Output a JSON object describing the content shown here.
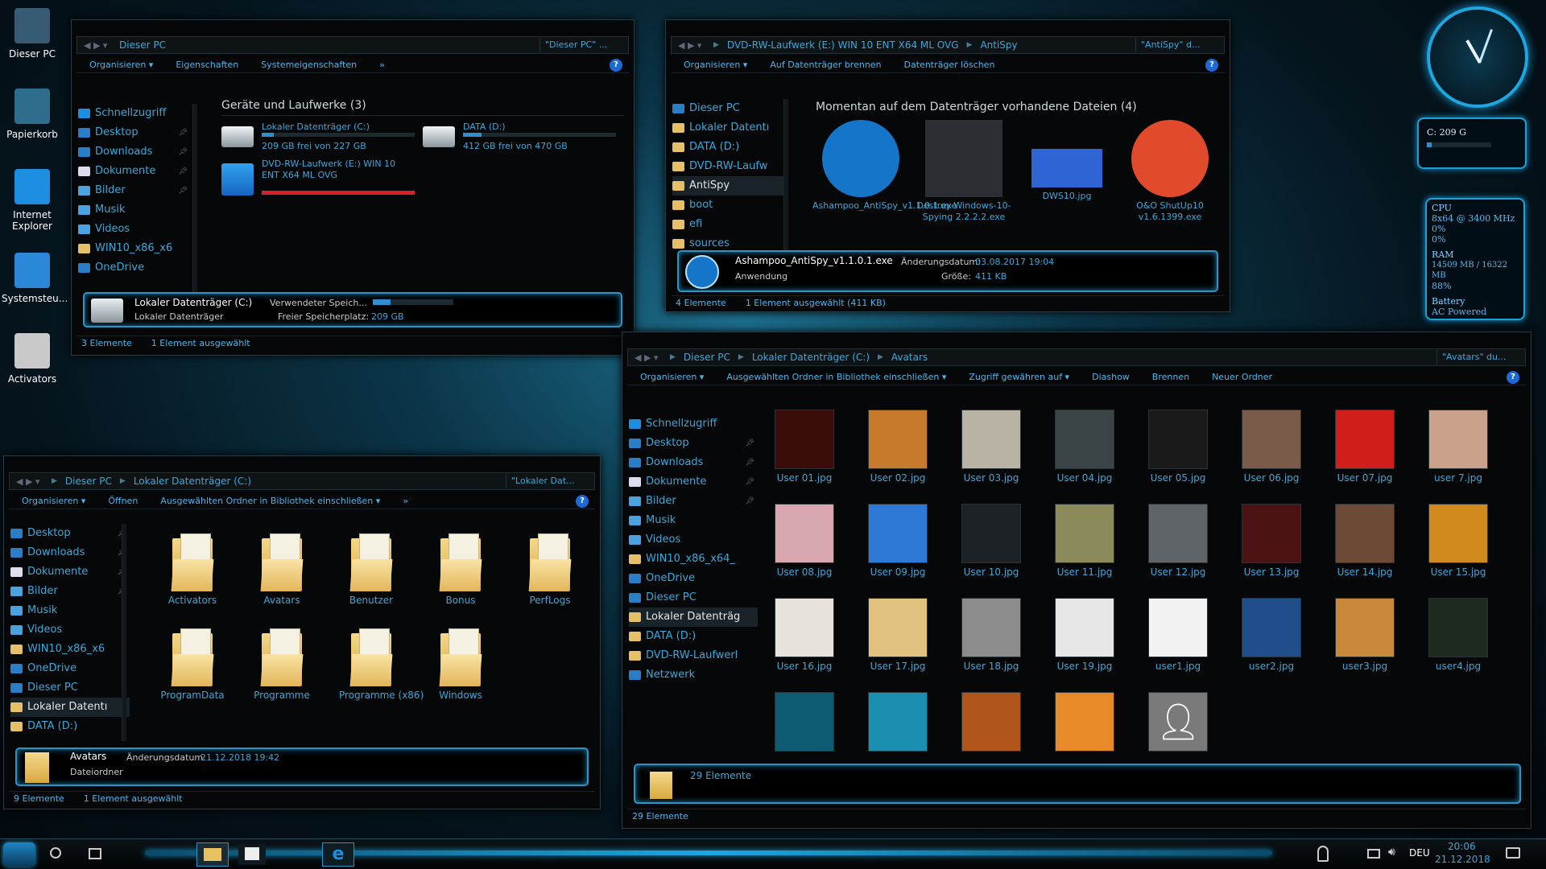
{
  "desktop": {
    "icons": [
      {
        "label": "Dieser PC",
        "color": "#365b72"
      },
      {
        "label": "Papierkorb",
        "color": "#2f6d8c"
      },
      {
        "label": "Internet Explorer",
        "color": "#1e8fe0"
      },
      {
        "label": "Systemsteu...",
        "color": "#2b88d8"
      },
      {
        "label": "Activators",
        "color": "#c9c9c9"
      }
    ]
  },
  "win_pc": {
    "address": {
      "crumbs": [
        "Dieser PC"
      ],
      "search": "\"Dieser PC\" ..."
    },
    "commands": [
      "Organisieren ▾",
      "Eigenschaften",
      "Systemeigenschaften",
      "»"
    ],
    "sidebar": [
      "Schnellzugriff",
      "Desktop",
      "Downloads",
      "Dokumente",
      "Bilder",
      "Musik",
      "Videos",
      "WIN10_x86_x6",
      "OneDrive"
    ],
    "group_title": "Geräte und Laufwerke (3)",
    "drives": [
      {
        "name": "Lokaler Datenträger (C:)",
        "free": "209 GB frei von 227 GB",
        "fill": 0.08,
        "bar": "#2d8ed0"
      },
      {
        "name": "DATA (D:)",
        "free": "412 GB frei von 470 GB",
        "fill": 0.12,
        "bar": "#2d8ed0"
      },
      {
        "name": "DVD-RW-Laufwerk (E:) WIN 10 ENT X64 ML OVG",
        "free": "",
        "fill": 1.0,
        "bar": "#d6202a"
      }
    ],
    "details": {
      "title": "Lokaler Datenträger (C:)",
      "used_label": "Verwendeter Speich...",
      "sub": "Lokaler Datenträger",
      "free_label": "Freier Speicherplatz:",
      "free_value": "209 GB"
    },
    "status": [
      "3 Elemente",
      "1 Element ausgewählt"
    ]
  },
  "win_antispy": {
    "address": {
      "crumbs": [
        "DVD-RW-Laufwerk (E:) WIN 10 ENT X64 ML OVG",
        "AntiSpy"
      ],
      "search": "\"AntiSpy\" d..."
    },
    "commands": [
      "Organisieren ▾",
      "Auf Datenträger brennen",
      "Datenträger löschen"
    ],
    "sidebar": [
      "Dieser PC",
      "Lokaler Datentı",
      "DATA (D:)",
      "DVD-RW-Laufw",
      "AntiSpy",
      "boot",
      "efi",
      "sources"
    ],
    "group_title": "Momentan auf dem Datenträger vorhandene Dateien (4)",
    "files": [
      {
        "name": "Ashampoo_AntiSpy_v1.1.0.1.exe",
        "color": "#1576c9"
      },
      {
        "name": "Destroy-Windows-10-Spying 2.2.2.2.exe",
        "color": "#2b2f33"
      },
      {
        "name": "DWS10.jpg",
        "color": "#2f64d4"
      },
      {
        "name": "O&O ShutUp10 v1.6.1399.exe",
        "color": "#e24a2c"
      }
    ],
    "details": {
      "title": "Ashampoo_AntiSpy_v1.1.0.1.exe",
      "date_label": "Änderungsdatum:",
      "date": "03.08.2017 19:04",
      "type": "Anwendung",
      "size_label": "Größe:",
      "size": "411 KB"
    },
    "status": [
      "4 Elemente",
      "1 Element ausgewählt (411 KB)"
    ]
  },
  "win_c": {
    "address": {
      "crumbs": [
        "Dieser PC",
        "Lokaler Datenträger (C:)"
      ],
      "search": "\"Lokaler Dat..."
    },
    "commands": [
      "Organisieren ▾",
      "Öffnen",
      "Ausgewählten Ordner in Bibliothek einschließen ▾",
      "»"
    ],
    "sidebar": [
      "Desktop",
      "Downloads",
      "Dokumente",
      "Bilder",
      "Musik",
      "Videos",
      "WIN10_x86_x6",
      "OneDrive",
      "Dieser PC",
      "Lokaler Datentı",
      "DATA (D:)"
    ],
    "folders": [
      "Activators",
      "Avatars",
      "Benutzer",
      "Bonus",
      "PerfLogs",
      "ProgramData",
      "Programme",
      "Programme (x86)",
      "Windows"
    ],
    "details": {
      "title": "Avatars",
      "date_label": "Änderungsdatum:",
      "date": "21.12.2018 19:42",
      "type": "Dateiordner"
    },
    "status": [
      "9 Elemente",
      "1 Element ausgewählt"
    ]
  },
  "win_avatars": {
    "address": {
      "crumbs": [
        "Dieser PC",
        "Lokaler Datenträger (C:)",
        "Avatars"
      ],
      "search": "\"Avatars\" du..."
    },
    "commands": [
      "Organisieren ▾",
      "Ausgewählten Ordner in Bibliothek einschließen ▾",
      "Zugriff gewähren auf ▾",
      "Diashow",
      "Brennen",
      "Neuer Ordner"
    ],
    "sidebar": [
      "Schnellzugriff",
      "Desktop",
      "Downloads",
      "Dokumente",
      "Bilder",
      "Musik",
      "Videos",
      "WIN10_x86_x64_",
      "OneDrive",
      "Dieser PC",
      "Lokaler Datenträg",
      "DATA (D:)",
      "DVD-RW-Laufwerl",
      "Netzwerk"
    ],
    "images": [
      {
        "name": "User 01.jpg",
        "color": "#3a0d0a"
      },
      {
        "name": "User 02.jpg",
        "color": "#c77a2c"
      },
      {
        "name": "User 03.jpg",
        "color": "#b9b3a5"
      },
      {
        "name": "User 04.jpg",
        "color": "#3b4446"
      },
      {
        "name": "User 05.jpg",
        "color": "#1a1a1a"
      },
      {
        "name": "User 06.jpg",
        "color": "#7a5a48"
      },
      {
        "name": "User 07.jpg",
        "color": "#d21d1d"
      },
      {
        "name": "user 7.jpg",
        "color": "#c9a08a"
      },
      {
        "name": "User 08.jpg",
        "color": "#d8a7b0"
      },
      {
        "name": "User 09.jpg",
        "color": "#2e78d6"
      },
      {
        "name": "User 10.jpg",
        "color": "#1d2226"
      },
      {
        "name": "User 11.jpg",
        "color": "#8a8a5a"
      },
      {
        "name": "User 12.jpg",
        "color": "#5e6468"
      },
      {
        "name": "User 13.jpg",
        "color": "#4a1212"
      },
      {
        "name": "User 14.jpg",
        "color": "#6d4a36"
      },
      {
        "name": "User 15.jpg",
        "color": "#d18a1e"
      },
      {
        "name": "User 16.jpg",
        "color": "#e7e2dc"
      },
      {
        "name": "User 17.jpg",
        "color": "#e0c27e"
      },
      {
        "name": "User 18.jpg",
        "color": "#8c8c8c"
      },
      {
        "name": "User 19.jpg",
        "color": "#e6e6e6"
      },
      {
        "name": "user1.jpg",
        "color": "#f2f2f2"
      },
      {
        "name": "user2.jpg",
        "color": "#1f4e8a"
      },
      {
        "name": "user3.jpg",
        "color": "#c88a3a"
      },
      {
        "name": "user4.jpg",
        "color": "#1c2a20"
      },
      {
        "name": "",
        "color": "#0d5a73"
      },
      {
        "name": "",
        "color": "#1a8fb0"
      },
      {
        "name": "",
        "color": "#b0561d"
      },
      {
        "name": "",
        "color": "#e88a2a"
      },
      {
        "name": "",
        "color": "#7a7a7a"
      }
    ],
    "details": {
      "title": "29 Elemente"
    },
    "status": [
      "29 Elemente"
    ]
  },
  "gadgets": {
    "disk": "C: 209 G",
    "cpu": {
      "title": "CPU",
      "model": "8x64 @ 3400 MHz",
      "core1": "0%",
      "core2": "0%"
    },
    "ram": {
      "title": "RAM",
      "used": "14509 MB / 16322 MB",
      "pct": "88%"
    },
    "battery": {
      "title": "Battery",
      "state": "AC Powered"
    }
  },
  "taskbar": {
    "language": "DEU",
    "time": "20:06",
    "date": "21.12.2018"
  }
}
